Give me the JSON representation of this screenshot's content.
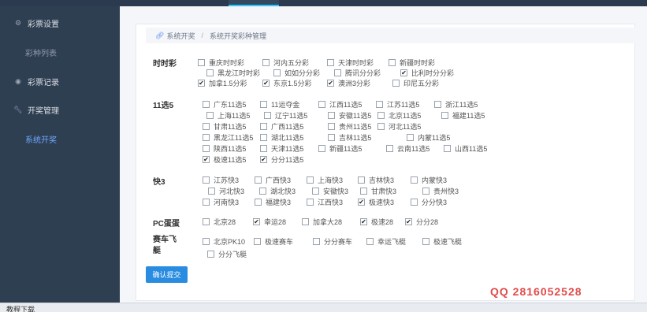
{
  "sidebar": {
    "items": [
      {
        "label": "彩票设置",
        "icon": "gear-icon"
      },
      {
        "label": "彩种列表",
        "icon": "none"
      },
      {
        "label": "彩票记录",
        "icon": "record-icon"
      },
      {
        "label": "开奖管理",
        "icon": "wrench-icon"
      },
      {
        "label": "系统开奖",
        "icon": "none"
      }
    ]
  },
  "breadcrumb": {
    "parent": "系统开奖",
    "current": "系统开奖彩种管理"
  },
  "groups": {
    "ssc": {
      "label": "时时彩",
      "options": [
        {
          "label": "重庆时时彩",
          "checked": false
        },
        {
          "label": "河内五分彩",
          "checked": false
        },
        {
          "label": "天津时时彩",
          "checked": false
        },
        {
          "label": "新疆时时彩",
          "checked": false
        },
        {
          "label": "黑龙江时时彩",
          "checked": false
        },
        {
          "label": "如如分分彩",
          "checked": false
        },
        {
          "label": "腾讯分分彩",
          "checked": false
        },
        {
          "label": "比利时分分彩",
          "checked": true
        },
        {
          "label": "加拿1.5分彩",
          "checked": true
        },
        {
          "label": "东京1.5分彩",
          "checked": true
        },
        {
          "label": "澳洲3分彩",
          "checked": true
        },
        {
          "label": "印尼五分彩",
          "checked": false
        }
      ]
    },
    "x11": {
      "label": "11选5",
      "options": [
        {
          "label": "广东11选5",
          "checked": false
        },
        {
          "label": "11运夺金",
          "checked": false
        },
        {
          "label": "江西11选5",
          "checked": false
        },
        {
          "label": "江苏11选5",
          "checked": false
        },
        {
          "label": "浙江11选5",
          "checked": false
        },
        {
          "label": "上海11选5",
          "checked": false
        },
        {
          "label": "辽宁11选5",
          "checked": false
        },
        {
          "label": "安徽11选5",
          "checked": false
        },
        {
          "label": "北京11选5",
          "checked": false
        },
        {
          "label": "福建11选5",
          "checked": false
        },
        {
          "label": "甘肃11选5",
          "checked": false
        },
        {
          "label": "广西11选5",
          "checked": false
        },
        {
          "label": "贵州11选5",
          "checked": false
        },
        {
          "label": "河北11选5",
          "checked": false
        },
        {
          "label": "黑龙江11选5",
          "checked": false
        },
        {
          "label": "湖北11选5",
          "checked": false
        },
        {
          "label": "吉林11选5",
          "checked": false
        },
        {
          "label": "内蒙11选5",
          "checked": false
        },
        {
          "label": "陕西11选5",
          "checked": false
        },
        {
          "label": "天津11选5",
          "checked": false
        },
        {
          "label": "新疆11选5",
          "checked": false
        },
        {
          "label": "云南11选5",
          "checked": false
        },
        {
          "label": "山西11选5",
          "checked": false
        },
        {
          "label": "极速11选5",
          "checked": true
        },
        {
          "label": "分分11选5",
          "checked": true
        }
      ]
    },
    "k3": {
      "label": "快3",
      "options": [
        {
          "label": "江苏快3",
          "checked": false
        },
        {
          "label": "广西快3",
          "checked": false
        },
        {
          "label": "上海快3",
          "checked": false
        },
        {
          "label": "吉林快3",
          "checked": false
        },
        {
          "label": "内蒙快3",
          "checked": false
        },
        {
          "label": "河北快3",
          "checked": false
        },
        {
          "label": "湖北快3",
          "checked": false
        },
        {
          "label": "安徽快3",
          "checked": false
        },
        {
          "label": "甘肃快3",
          "checked": false
        },
        {
          "label": "贵州快3",
          "checked": false
        },
        {
          "label": "河南快3",
          "checked": false
        },
        {
          "label": "福建快3",
          "checked": false
        },
        {
          "label": "江西快3",
          "checked": false
        },
        {
          "label": "极速快3",
          "checked": true
        },
        {
          "label": "分分快3",
          "checked": false
        }
      ]
    },
    "pc": {
      "label": "PC蛋蛋",
      "options": [
        {
          "label": "北京28",
          "checked": false
        },
        {
          "label": "幸运28",
          "checked": true
        },
        {
          "label": "加拿大28",
          "checked": false
        },
        {
          "label": "极速28",
          "checked": true
        },
        {
          "label": "分分28",
          "checked": true
        }
      ]
    },
    "pk": {
      "label": "赛车飞艇",
      "options": [
        {
          "label": "北京PK10",
          "checked": false
        },
        {
          "label": "极速赛车",
          "checked": false
        },
        {
          "label": "分分赛车",
          "checked": false
        },
        {
          "label": "幸运飞艇",
          "checked": false
        },
        {
          "label": "极速飞艇",
          "checked": false
        },
        {
          "label": "分分飞艇",
          "checked": false
        }
      ]
    }
  },
  "submit_label": "确认提交",
  "contact": "QQ 2816052528",
  "bottom_caption": "教程下载"
}
